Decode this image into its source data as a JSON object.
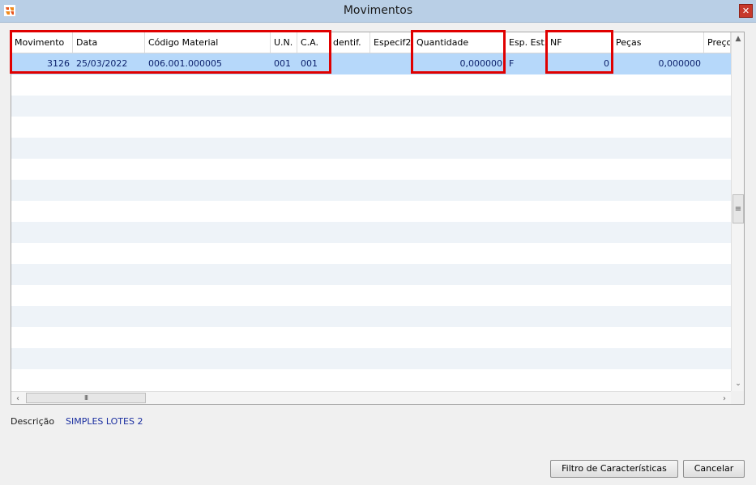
{
  "window": {
    "title": "Movimentos",
    "close_glyph": "✕"
  },
  "grid": {
    "columns": [
      {
        "key": "movimento",
        "label": "Movimento"
      },
      {
        "key": "data",
        "label": "Data"
      },
      {
        "key": "codigo",
        "label": "Código Material"
      },
      {
        "key": "un",
        "label": "U.N."
      },
      {
        "key": "ca",
        "label": "C.A."
      },
      {
        "key": "identif",
        "label": "dentif."
      },
      {
        "key": "especif2",
        "label": "Especif2"
      },
      {
        "key": "quantidade",
        "label": "Quantidade"
      },
      {
        "key": "esp_est",
        "label": "Esp. Est."
      },
      {
        "key": "nf",
        "label": "NF"
      },
      {
        "key": "pecas",
        "label": "Peças"
      },
      {
        "key": "preco",
        "label": "Preço"
      }
    ],
    "rows": [
      {
        "movimento": "3126",
        "data": "25/03/2022",
        "codigo": "006.001.000005",
        "un": "001",
        "ca": "001",
        "identif": "",
        "especif2": "",
        "quantidade": "0,000000",
        "esp_est": "F",
        "nf": "0",
        "pecas": "0,000000",
        "preco": ""
      }
    ],
    "scroll": {
      "up_glyph": "▲",
      "down_glyph": "⌄",
      "left_glyph": "‹",
      "right_glyph": "›",
      "vthumb_glyph": "≡",
      "hthumb_glyph": "III"
    }
  },
  "description": {
    "label": "Descrição",
    "value": "SIMPLES LOTES 2"
  },
  "buttons": {
    "filtro": "Filtro de Características",
    "cancelar": "Cancelar"
  },
  "colors": {
    "highlight": "#e00000",
    "selected_row": "#b6d8fa",
    "titlebar": "#b9cfe6"
  }
}
